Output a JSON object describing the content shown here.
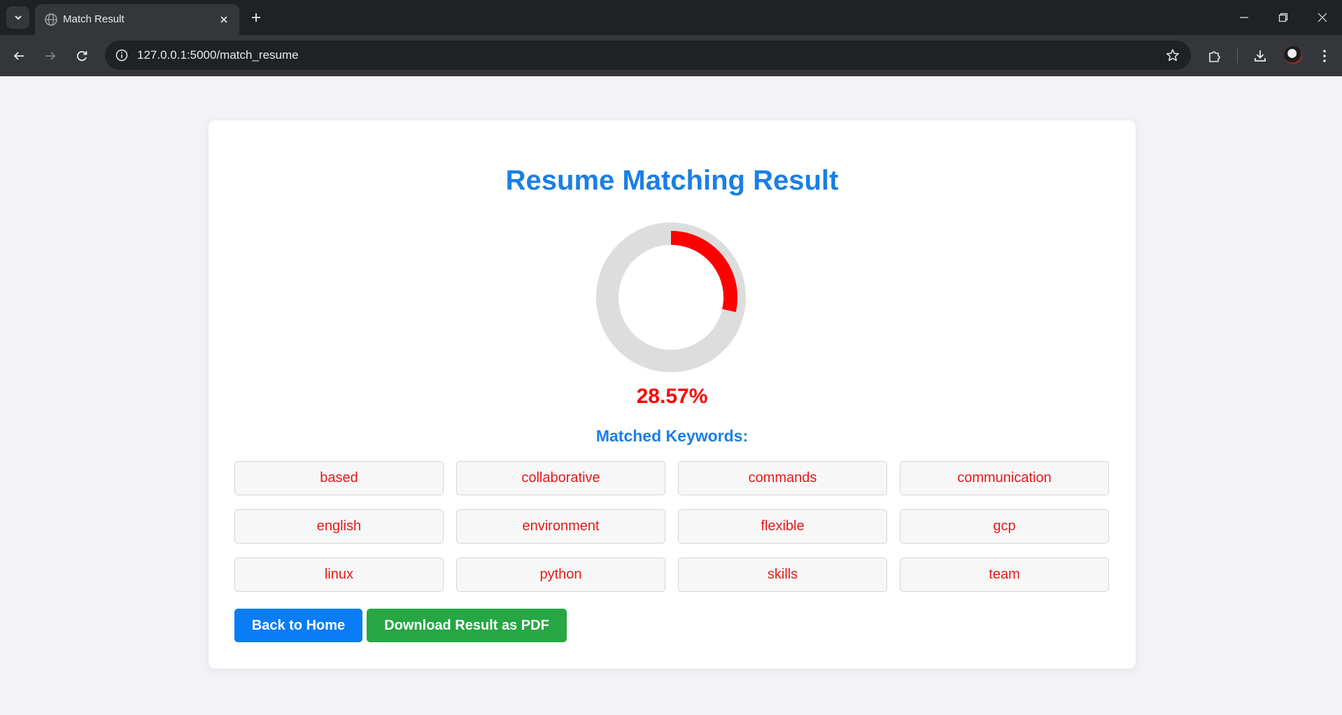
{
  "browser": {
    "tab_title": "Match Result",
    "url": "127.0.0.1:5000/match_resume"
  },
  "page": {
    "title": "Resume Matching Result",
    "score_text": "28.57%",
    "score_percent": 28.57,
    "keywords_heading": "Matched Keywords:",
    "keywords": [
      "based",
      "collaborative",
      "commands",
      "communication",
      "english",
      "environment",
      "flexible",
      "gcp",
      "linux",
      "python",
      "skills",
      "team"
    ],
    "back_button": "Back to Home",
    "download_button": "Download Result as PDF"
  },
  "colors": {
    "accent_blue": "#1a7fe6",
    "score_red": "#ff0000",
    "keyword_red": "#e31b1b",
    "home_button": "#0a7cf5",
    "pdf_button": "#27a644",
    "gauge_track": "#dddddd"
  },
  "icons": {
    "tab_search": "chevron-down-icon",
    "favicon": "globe-icon",
    "tab_close": "close-icon",
    "new_tab": "plus-icon",
    "back": "arrow-left-icon",
    "forward": "arrow-right-icon",
    "reload": "reload-icon",
    "site_info": "info-icon",
    "bookmark": "star-icon",
    "extensions": "puzzle-icon",
    "downloads": "download-icon",
    "menu": "kebab-menu-icon"
  }
}
